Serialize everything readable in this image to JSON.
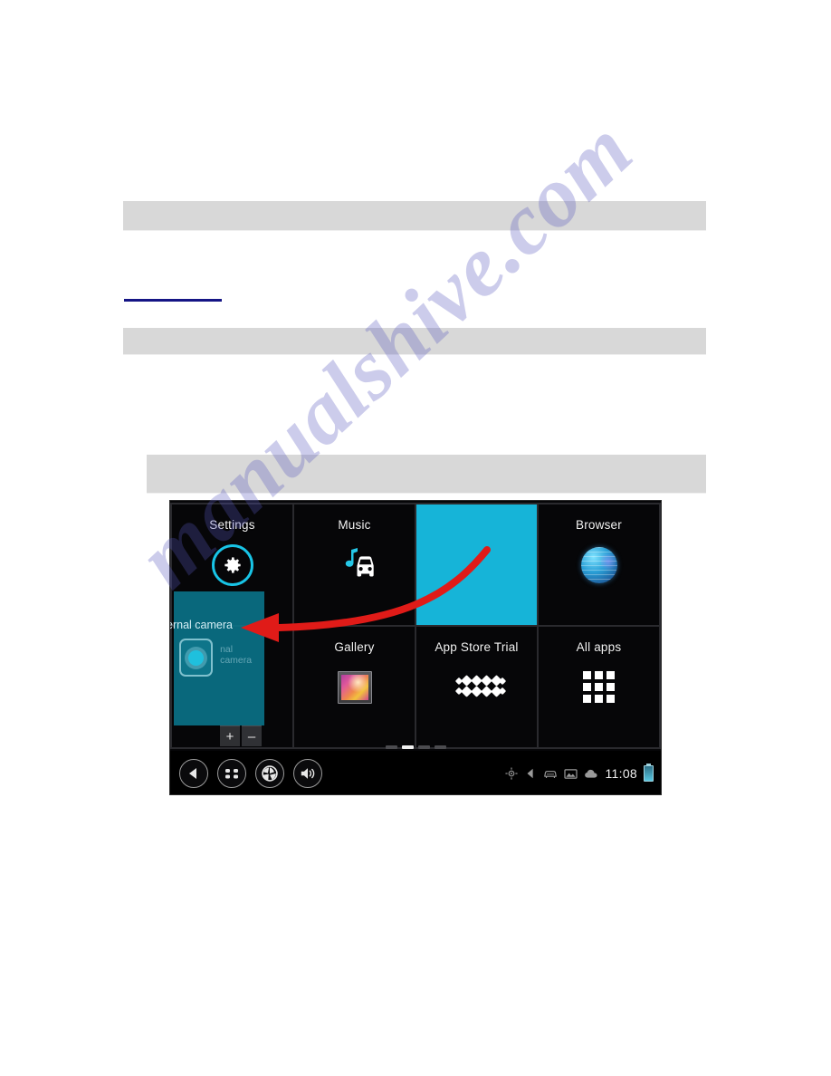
{
  "document": {
    "watermark": "manualshive.com",
    "redacted_bars": 3,
    "link_underline_color": "#151585",
    "bar_color": "#d8d8d8"
  },
  "screenshot": {
    "device": "android-tablet-home-screen",
    "accent_color": "#16b4d8",
    "arrow_color": "#e01b18",
    "tiles": [
      {
        "label": "Settings",
        "icon": "gear-icon",
        "selected": false
      },
      {
        "label": "Music",
        "icon": "music-car-icon",
        "selected": false
      },
      {
        "label": "",
        "icon": "empty-icon",
        "selected": true
      },
      {
        "label": "Browser",
        "icon": "globe-icon",
        "selected": false
      },
      {
        "label": "",
        "icon": "hidden-icon",
        "selected": false
      },
      {
        "label": "Gallery",
        "icon": "photo-frame-icon",
        "selected": false
      },
      {
        "label": "App Store Trial",
        "icon": "app-store-icon",
        "selected": false
      },
      {
        "label": "All apps",
        "icon": "grid-apps-icon",
        "selected": false
      }
    ],
    "camera_popup": {
      "title": "ernal camera",
      "subtitle": "nal camera",
      "icon": "camera-icon",
      "add_button": "+",
      "remove_button": "–"
    },
    "page_indicator": {
      "count": 4,
      "active_index": 1
    },
    "navbar": {
      "buttons": [
        {
          "icon": "back-icon",
          "label": "Back"
        },
        {
          "icon": "recent-apps-icon",
          "label": "Recent apps"
        },
        {
          "icon": "camera-shutter-icon",
          "label": "Camera"
        },
        {
          "icon": "volume-icon",
          "label": "Volume"
        }
      ],
      "status_icons": [
        "gps-icon",
        "sound-mute-icon",
        "car-icon",
        "picture-icon",
        "cloud-icon"
      ],
      "clock": "11:08",
      "battery": "battery-icon"
    }
  }
}
